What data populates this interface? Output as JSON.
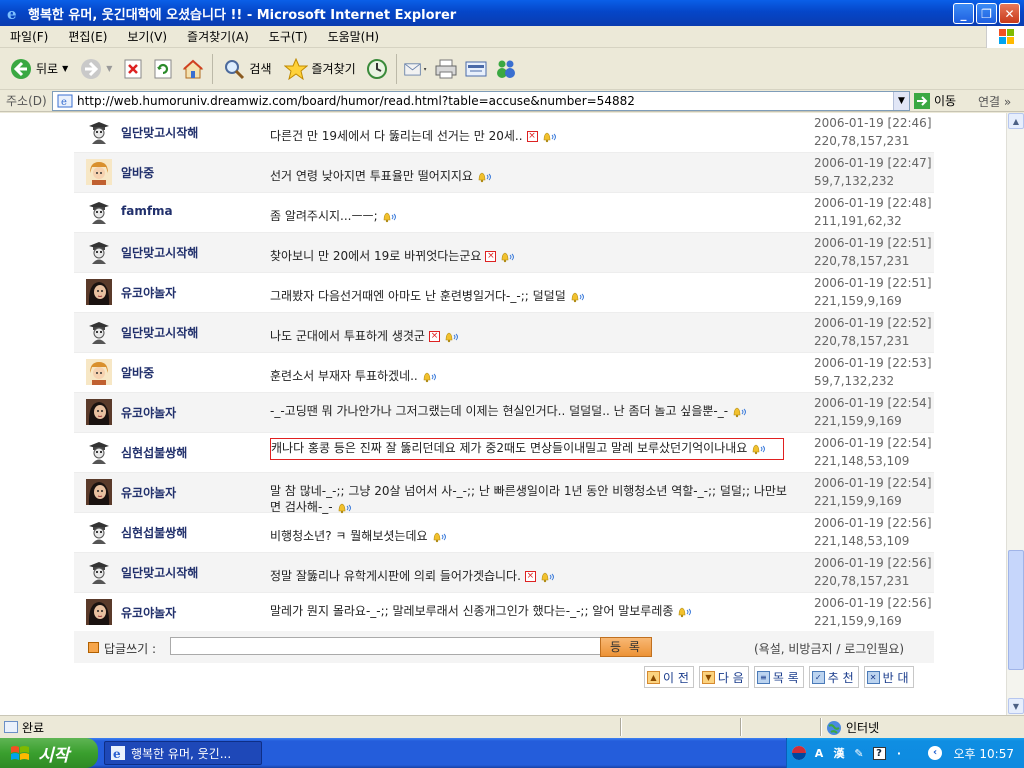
{
  "window": {
    "title": "행복한 유머, 웃긴대학에 오셨습니다 !! - Microsoft Internet Explorer"
  },
  "menu": [
    "파일(F)",
    "편집(E)",
    "보기(V)",
    "즐겨찾기(A)",
    "도구(T)",
    "도움말(H)"
  ],
  "toolbar": {
    "back": "뒤로",
    "search": "검색",
    "favorites": "즐겨찾기"
  },
  "address": {
    "label": "주소(D)",
    "url": "http://web.humoruniv.dreamwiz.com/board/humor/read.html?table=accuse&number=54882",
    "go": "이동",
    "links": "연결"
  },
  "comments": [
    {
      "name": "일단맞고시작해",
      "avatar": "hat",
      "text": "다른건 만 19세에서 다 뚫리는데 선거는 만 20세..",
      "x": true,
      "date": "2006-01-19 [22:46]",
      "ip": "220,78,157,231"
    },
    {
      "name": "알바중",
      "avatar": "blond",
      "text": "선거 연령 낮아지면 투표율만 떨어지지요",
      "x": false,
      "date": "2006-01-19 [22:47]",
      "ip": "59,7,132,232"
    },
    {
      "name": "famfma",
      "avatar": "hat",
      "text": "좀 알려주시지...ㅡㅡ;",
      "x": false,
      "date": "2006-01-19 [22:48]",
      "ip": "211,191,62,32"
    },
    {
      "name": "일단맞고시작해",
      "avatar": "hat",
      "text": "찾아보니 만 20에서 19로 바뀌엇다는군요",
      "x": true,
      "date": "2006-01-19 [22:51]",
      "ip": "220,78,157,231"
    },
    {
      "name": "유코야놀자",
      "avatar": "girl",
      "text": "그래봤자 다음선거때엔 아마도 난 훈련병일거다-_-;; 덜덜덜",
      "x": false,
      "date": "2006-01-19 [22:51]",
      "ip": "221,159,9,169"
    },
    {
      "name": "일단맞고시작해",
      "avatar": "hat",
      "text": "나도 군대에서 투표하게 생겻군",
      "x": true,
      "date": "2006-01-19 [22:52]",
      "ip": "220,78,157,231"
    },
    {
      "name": "알바중",
      "avatar": "blond",
      "text": "훈련소서 부재자 투표하겠네..",
      "x": false,
      "date": "2006-01-19 [22:53]",
      "ip": "59,7,132,232"
    },
    {
      "name": "유코야놀자",
      "avatar": "girl",
      "text": "-_-고딩땐 뭐 가나안가나 그저그랬는데 이제는 현실인거다.. 덜덜덜.. 난 좀더 놀고 싶을뿐-_-",
      "x": false,
      "date": "2006-01-19 [22:54]",
      "ip": "221,159,9,169"
    },
    {
      "name": "심현섭불쌍해",
      "avatar": "hat",
      "text": "캐나다 홍콩 등은 진짜 잘 뚫리던데요 제가 중2때도 면상들이내밀고 말레 보루샀던기억이나내요",
      "x": false,
      "date": "2006-01-19 [22:54]",
      "ip": "221,148,53,109"
    },
    {
      "name": "유코야놀자",
      "avatar": "girl",
      "text": "말 참 많네-_-;; 그냥 20살 넘어서 사-_-;; 난 빠른생일이라 1년 동안 비행청소년 역할-_-;; 덜덜;; 나만보면 검사해-_-",
      "x": false,
      "date": "2006-01-19 [22:54]",
      "ip": "221,159,9,169"
    },
    {
      "name": "심현섭불쌍해",
      "avatar": "hat",
      "text": "비행청소년? ㅋ 뭘해보셧는데요",
      "x": false,
      "date": "2006-01-19 [22:56]",
      "ip": "221,148,53,109"
    },
    {
      "name": "일단맞고시작해",
      "avatar": "hat",
      "text": "정말 잘뚫리나 유학게시판에 의뢰 들어가겟습니다.",
      "x": true,
      "date": "2006-01-19 [22:56]",
      "ip": "220,78,157,231"
    },
    {
      "name": "유코야놀자",
      "avatar": "girl",
      "text": "말레가 뭔지 몰라요-_-;; 말레보루래서 신종개그인가 했다는-_-;; 알어 말보루레종",
      "x": false,
      "date": "2006-01-19 [22:56]",
      "ip": "221,159,9,169"
    }
  ],
  "reply": {
    "label": "답글쓰기 :",
    "button": "등 록",
    "note": "(욕설, 비방금지 / 로그인필요)"
  },
  "nav": {
    "prev": "이 전",
    "next": "다 음",
    "list": "목 록",
    "recommend": "추 천",
    "oppose": "반 대"
  },
  "status": {
    "text": "완료",
    "zone": "인터넷"
  },
  "taskbar": {
    "start": "시작",
    "task": "행복한 유머, 웃긴...",
    "ime_a": "A",
    "ime_han": "漢",
    "clock": "오후 10:57"
  },
  "colors": {
    "titlebar": "#0A5FE8",
    "name": "#21306C",
    "highlight_border": "#E02020",
    "button_orange": "#EC9236"
  }
}
